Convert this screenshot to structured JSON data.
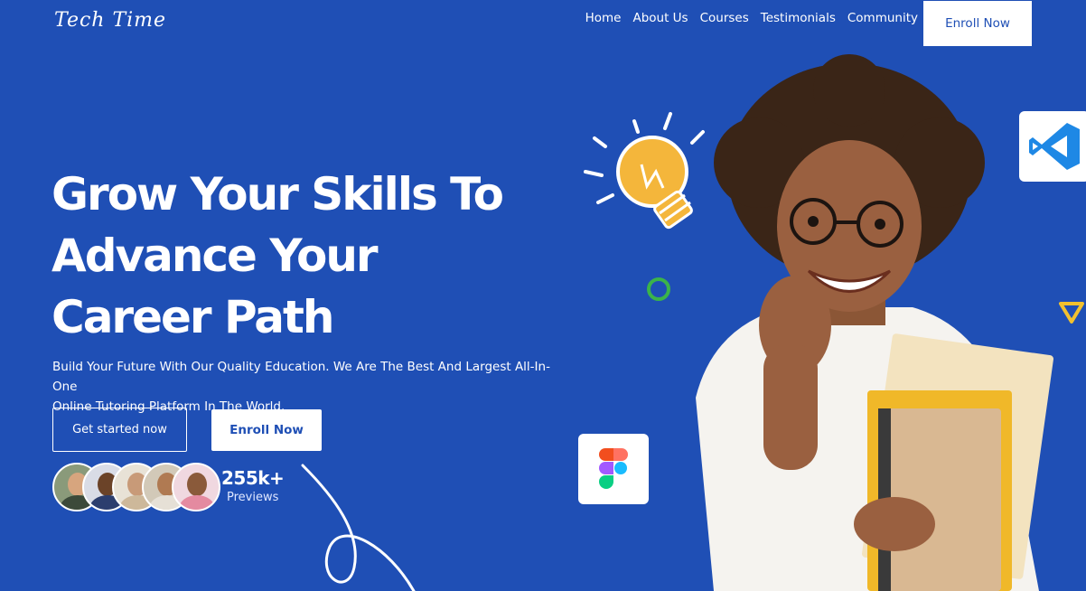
{
  "brand": {
    "logo": "Tech Time"
  },
  "nav": {
    "links": [
      "Home",
      "About Us",
      "Courses",
      "Testimonials",
      "Community"
    ],
    "cta": "Enroll Now"
  },
  "hero": {
    "title_lines": [
      "Grow Your Skills To",
      "Advance Your",
      "Career Path"
    ],
    "subtitle_lines": [
      "Build Your Future With Our Quality Education. We Are The Best And Largest All-In-One",
      "Online Tutoring Platform In The World."
    ],
    "primary_button": "Get started now",
    "secondary_button": "Enroll Now"
  },
  "social_proof": {
    "count": "255k+",
    "label": "Previews"
  },
  "colors": {
    "background": "#1f4fb5",
    "white": "#ffffff",
    "bulb": "#f4b63b",
    "ring": "#3bb34a",
    "triangle": "#f2c12e",
    "vscode": "#1e88e5"
  },
  "icons": [
    "vscode-icon",
    "figma-icon",
    "lightbulb-icon"
  ]
}
